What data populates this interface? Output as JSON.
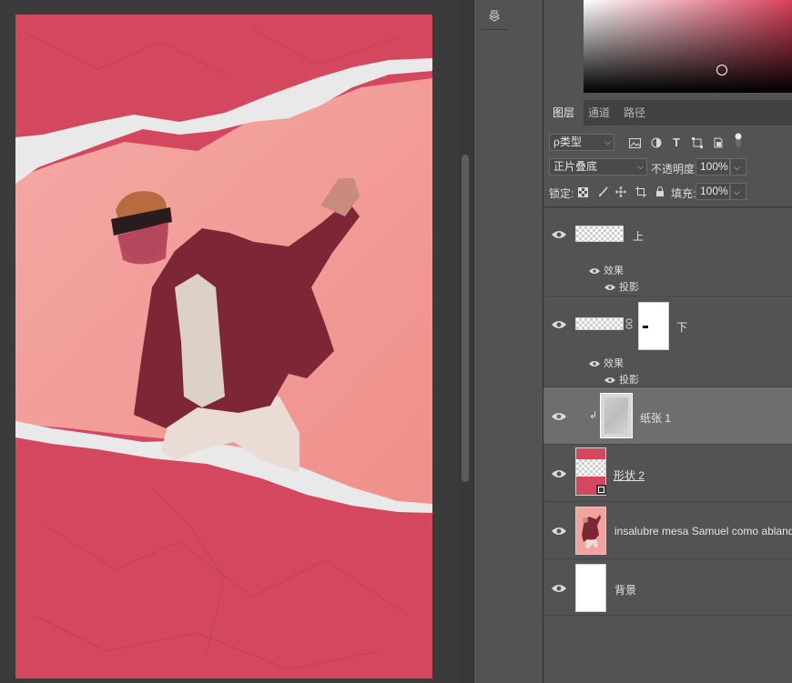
{
  "layers_panel": {
    "tabs": [
      {
        "label": "图层",
        "active": true
      },
      {
        "label": "通道",
        "active": false
      },
      {
        "label": "路径",
        "active": false
      }
    ],
    "filter_kind": "ρ类型",
    "blend_mode": "正片叠底",
    "opacity_label": "不透明度:",
    "opacity_value": "100%",
    "lock_label": "锁定:",
    "fill_label": "填充:",
    "fill_value": "100%",
    "layers": [
      {
        "name": "上",
        "effects_label": "效果",
        "effect": "投影"
      },
      {
        "name": "下",
        "effects_label": "效果",
        "effect": "投影"
      },
      {
        "name": "纸张 1"
      },
      {
        "name": "形状 2"
      },
      {
        "name": "insalubre mesa Samuel como ablandar"
      },
      {
        "name": "背景"
      }
    ]
  },
  "colors": {
    "accent": "#d4485f",
    "panel": "#535353",
    "selected_row": "#6e6e6e"
  }
}
